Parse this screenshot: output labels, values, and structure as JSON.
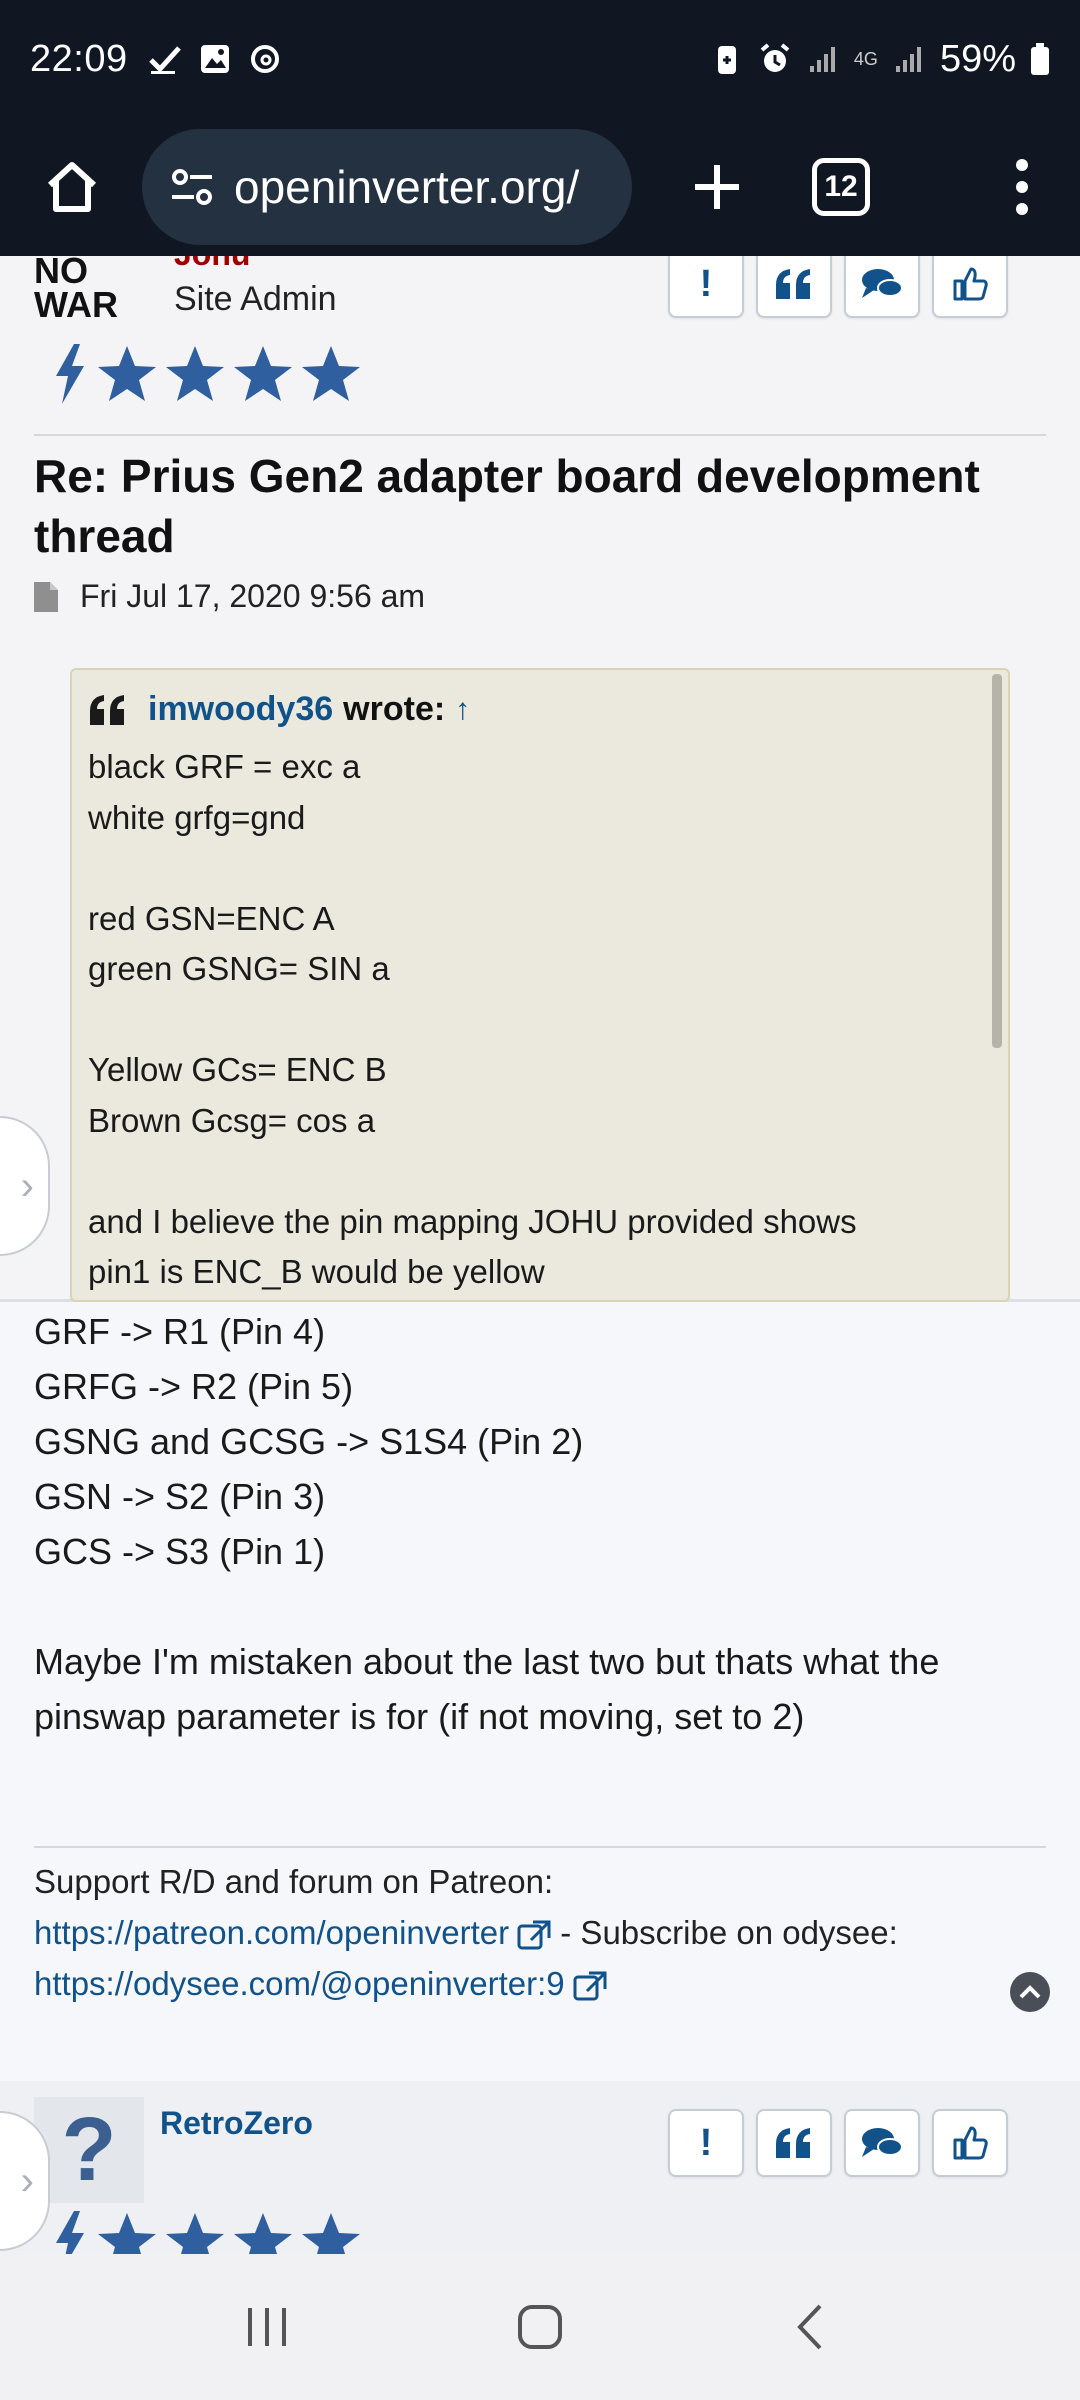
{
  "status_bar": {
    "time": "22:09",
    "battery": "59%",
    "network": "4G",
    "icons": [
      "check-icon",
      "image-icon",
      "threads-icon",
      "battery-saver-icon",
      "alarm-icon",
      "signal-icon",
      "signal-icon",
      "battery-icon"
    ]
  },
  "browser": {
    "url": "openinverter.org/",
    "tab_count": "12"
  },
  "post1": {
    "author": "Johu",
    "rank": "Site Admin",
    "avatar_text_line1": "NO",
    "avatar_text_line2": "WAR",
    "title": "Re: Prius Gen2 adapter board development thread",
    "date": "Fri Jul 17, 2020 9:56 am",
    "quote": {
      "author": "imwoody36",
      "wrote": "wrote:",
      "arrow": "↑",
      "lines": [
        "black GRF = exc a",
        "white grfg=gnd",
        "",
        "red GSN=ENC A",
        "green GSNG= SIN a",
        "",
        "Yellow GCs= ENC B",
        "Brown Gcsg= cos a",
        "",
        "and I believe the pin mapping JOHU provided shows",
        "pin1 is ENC_B would be yellow"
      ]
    },
    "body_lines": [
      "GRF -> R1 (Pin 4)",
      "GRFG -> R2 (Pin 5)",
      "GSNG and GCSG -> S1S4 (Pin 2)",
      "GSN -> S2 (Pin 3)",
      "GCS -> S3 (Pin 1)",
      "",
      "Maybe I'm mistaken about the last two but thats what the pinswap parameter is for (if not moving, set to 2)"
    ],
    "signature": {
      "line1": "Support R/D and forum on Patreon:",
      "patreon_link": "https://patreon.com/openinverter",
      "middle": " - Subscribe on odysee:",
      "odysee_link": "https://odysee.com/@openinverter:9"
    }
  },
  "post2": {
    "author": "RetroZero",
    "avatar_glyph": "?"
  },
  "colors": {
    "link": "#105289",
    "admin_name": "#a00000",
    "status_bg": "#101722",
    "quote_bg": "#ebe9de",
    "star": "#2f5f9e"
  }
}
